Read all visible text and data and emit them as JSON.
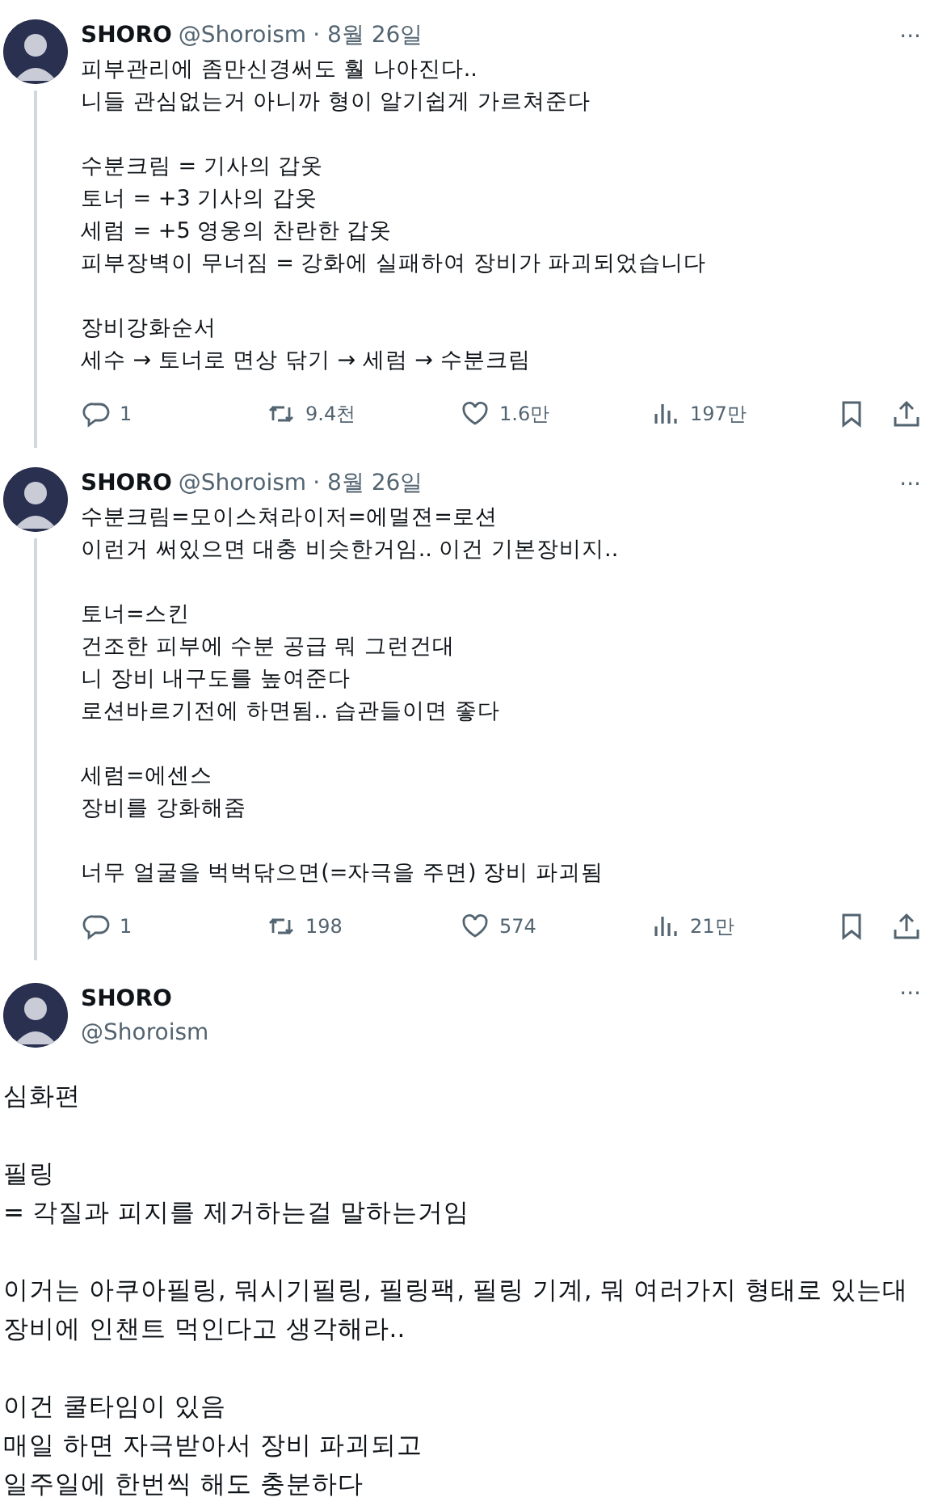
{
  "thread": [
    {
      "name": "SHORO",
      "handle": "@Shoroism",
      "date": "· 8월 26일",
      "more": "···",
      "paragraphs": [
        "피부관리에 좀만신경써도 훨 나아진다..\n니들 관심없는거 아니까 형이 알기쉽게 가르쳐준다",
        "수분크림 = 기사의 갑옷\n토너 = +3 기사의 갑옷\n세럼 = +5 영웅의 찬란한 갑옷\n피부장벽이 무너짐 = 강화에 실패하여 장비가 파괴되었습니다",
        "장비강화순서\n세수 → 토너로 면상 닦기 → 세럼 → 수분크림"
      ],
      "stats": {
        "replies": "1",
        "reposts": "9.4천",
        "likes": "1.6만",
        "views": "197만"
      }
    },
    {
      "name": "SHORO",
      "handle": "@Shoroism",
      "date": "· 8월 26일",
      "more": "···",
      "paragraphs": [
        "수분크림=모이스쳐라이저=에멀젼=로션\n이런거 써있으면 대충 비슷한거임.. 이건 기본장비지..",
        "토너=스킨\n건조한 피부에 수분 공급 뭐 그런건대\n니 장비 내구도를 높여준다\n로션바르기전에 하면됨.. 습관들이면 좋다",
        "세럼=에센스\n장비를 강화해줌",
        "너무 얼굴을 벅벅닦으면(=자극을 주면) 장비 파괴됨"
      ],
      "stats": {
        "replies": "1",
        "reposts": "198",
        "likes": "574",
        "views": "21만"
      }
    }
  ],
  "main_tweet": {
    "name": "SHORO",
    "handle": "@Shoroism",
    "more": "···",
    "paragraphs": [
      "심화편",
      "필링\n= 각질과 피지를 제거하는걸 말하는거임",
      "이거는  아쿠아필링, 뭐시기필링, 필링팩, 필링 기계, 뭐 여러가지 형태로 있는대\n장비에 인챈트 먹인다고 생각해라..",
      "이건 쿨타임이 있음\n매일 하면 자극받아서 장비 파괴되고\n일주일에 한번씩 해도 충분하다"
    ]
  }
}
